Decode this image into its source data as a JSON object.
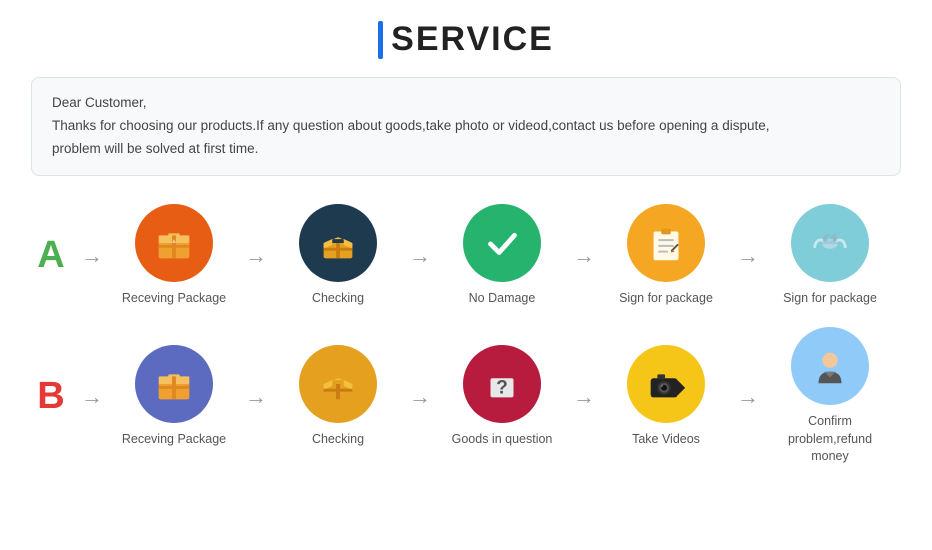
{
  "title": {
    "bar_color": "#1a6fe8",
    "text": "SERVICE"
  },
  "notice": {
    "line1": "Dear Customer,",
    "line2": "Thanks for choosing our products.If any question about goods,take photo or videod,contact us before opening a dispute,",
    "line3": "problem will be solved at first time."
  },
  "row_a": {
    "label": "A",
    "steps": [
      {
        "id": "recv-pkg-a",
        "label": "Receving Package",
        "icon": "box-orange"
      },
      {
        "id": "checking-a",
        "label": "Checking",
        "icon": "box-open-dark"
      },
      {
        "id": "no-damage-a",
        "label": "No Damage",
        "icon": "checkmark-green"
      },
      {
        "id": "sign-pkg-a",
        "label": "Sign for package",
        "icon": "sign-yellow"
      },
      {
        "id": "sign-pkg-a2",
        "label": "Sign for package",
        "icon": "handshake-blue"
      }
    ]
  },
  "row_b": {
    "label": "B",
    "steps": [
      {
        "id": "recv-pkg-b",
        "label": "Receving Package",
        "icon": "box-purple"
      },
      {
        "id": "checking-b",
        "label": "Checking",
        "icon": "box-open-gold"
      },
      {
        "id": "goods-question-b",
        "label": "Goods in question",
        "icon": "question-red"
      },
      {
        "id": "take-videos-b",
        "label": "Take Videos",
        "icon": "camera-yellow"
      },
      {
        "id": "confirm-refund-b",
        "label": "Confirm problem,refund\nmoney",
        "icon": "person-sky"
      }
    ]
  }
}
